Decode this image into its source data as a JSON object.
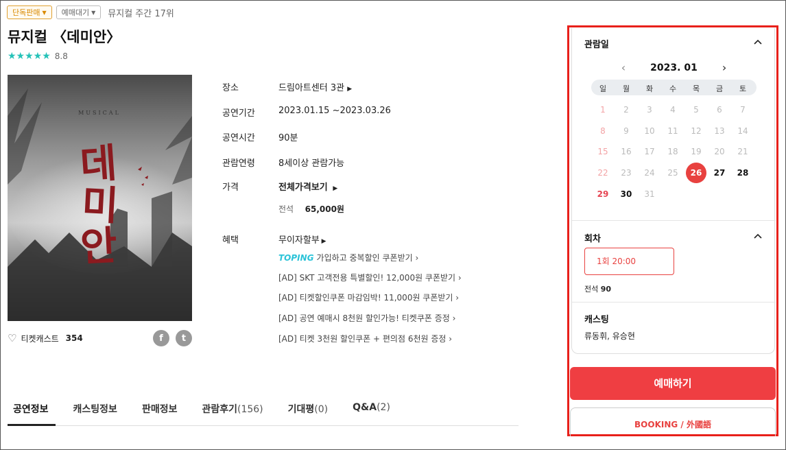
{
  "tags": {
    "exclusive": "단독판매",
    "waiting": "예매대기",
    "rank": "뮤지컬 주간 17위"
  },
  "title": "뮤지컬 〈데미안〉",
  "rating": {
    "stars": "★★★★★",
    "score": "8.8"
  },
  "poster": {
    "musical_text": "MUSICAL",
    "title_text": "데미안"
  },
  "likes": {
    "label": "티켓캐스트",
    "count": "354"
  },
  "share": {
    "facebook": "f",
    "twitter": "t"
  },
  "info": {
    "venue_label": "장소",
    "venue": "드림아트센터 3관",
    "period_label": "공연기간",
    "period": "2023.01.15 ~2023.03.26",
    "runtime_label": "공연시간",
    "runtime": "90분",
    "age_label": "관람연령",
    "age": "8세이상 관람가능",
    "price_label": "가격",
    "price_link": "전체가격보기",
    "seat_type": "전석",
    "seat_price": "65,000원",
    "benefit_label": "혜택",
    "benefits": [
      "무이자할부",
      "가입하고 중복할인 쿠폰받기",
      "[AD] SKT 고객전용 특별할인! 12,000원 쿠폰받기",
      "[AD] 티켓할인쿠폰 마감임박! 11,000원 쿠폰받기",
      "[AD] 공연 예매시 8천원 할인가능! 티켓쿠폰 증정",
      "[AD] 티켓 3천원 할인쿠폰 + 편의점 6천원 증정"
    ],
    "toping": "TOPING"
  },
  "tabs": [
    {
      "label": "공연정보",
      "count": ""
    },
    {
      "label": "캐스팅정보",
      "count": ""
    },
    {
      "label": "판매정보",
      "count": ""
    },
    {
      "label": "관람후기",
      "count": "(156)"
    },
    {
      "label": "기대평",
      "count": "(0)"
    },
    {
      "label": "Q&A",
      "count": "(2)"
    }
  ],
  "calendar": {
    "section_title": "관람일",
    "month": "2023. 01",
    "weekdays": [
      "일",
      "월",
      "화",
      "수",
      "목",
      "금",
      "토"
    ],
    "selected_day": "26",
    "days": [
      "1",
      "2",
      "3",
      "4",
      "5",
      "6",
      "7",
      "8",
      "9",
      "10",
      "11",
      "12",
      "13",
      "14",
      "15",
      "16",
      "17",
      "18",
      "19",
      "20",
      "21",
      "22",
      "23",
      "24",
      "25",
      "26",
      "27",
      "28",
      "29",
      "30",
      "31"
    ],
    "available_days": [
      "26",
      "27",
      "28",
      "29",
      "30"
    ]
  },
  "round": {
    "section_title": "회차",
    "button": "1회 20:00",
    "seat_label": "전석",
    "seat_count": "90"
  },
  "casting": {
    "section_title": "캐스팅",
    "names": "류동휘, 유승현"
  },
  "booking": {
    "primary": "예매하기",
    "foreign": "BOOKING / 外國語"
  },
  "colors": {
    "accent": "#ef3e42",
    "star": "#25c2b8",
    "highlight_outline": "#e8201a"
  }
}
